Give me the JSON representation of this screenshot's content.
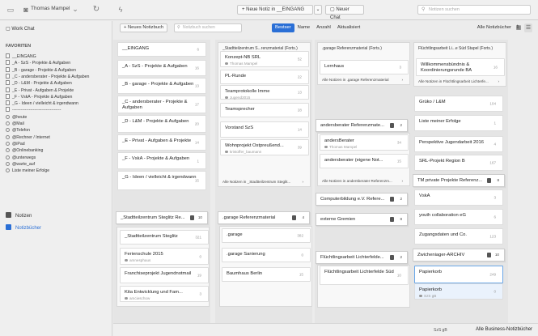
{
  "top": {
    "user": "Thomas Mampel",
    "new_note_label": "+ Neue Notiz in __EINGANG",
    "new_chat_label": "Neuer Chat",
    "search_placeholder": "Notizen suchen"
  },
  "sidebar": {
    "work_chat": "Work Chat",
    "favorites_heading": "FAVORITEN",
    "favorites": [
      {
        "label": "__EINGANG",
        "type": "notebook"
      },
      {
        "label": "_A - SzS - Projekte & Aufgaben",
        "type": "notebook"
      },
      {
        "label": "_B - garage - Projekte & Aufgaben",
        "type": "notebook"
      },
      {
        "label": "_C - andersberater - Projekte & Aufgaben",
        "type": "notebook"
      },
      {
        "label": "_D - L&M - Projekte & Aufgaben",
        "type": "notebook"
      },
      {
        "label": "_E - Privat - Aufgaben & Projekte",
        "type": "notebook"
      },
      {
        "label": "_F - VskA - Projekte & Aufgaben",
        "type": "notebook"
      },
      {
        "label": "_G - Ideen / vielleicht & irgendwann",
        "type": "notebook"
      },
      {
        "label": "-----------------------------------",
        "type": "notebook"
      },
      {
        "label": "@heute",
        "type": "tag"
      },
      {
        "label": "@Mail",
        "type": "tag"
      },
      {
        "label": "@Telefon",
        "type": "tag"
      },
      {
        "label": "@Rechner / Internet",
        "type": "tag"
      },
      {
        "label": "@iPad",
        "type": "tag"
      },
      {
        "label": "@Onlinebanking",
        "type": "tag"
      },
      {
        "label": "@unterwegs",
        "type": "tag"
      },
      {
        "label": "@warte_auf",
        "type": "tag"
      },
      {
        "label": "Liste meiner Erfolge",
        "type": "tag"
      }
    ],
    "notes_label": "Notizen",
    "notebooks_label": "Notizbücher"
  },
  "toolbar": {
    "new_notebook": "+ Neues Notizbuch",
    "search_placeholder": "Notizbuch suchen",
    "sort_options": [
      "Bestser",
      "Name",
      "Anzahl",
      "Aktualisiert"
    ],
    "sort_active": "Bestser",
    "filter_value": "Alle Notizbücher"
  },
  "col1": {
    "cards": [
      {
        "t": "__EINGANG",
        "n": "6"
      },
      {
        "t": "_A - SzS - Projekte & Aufgaben",
        "n": "16"
      },
      {
        "t": "_B - garage - Projekte & Aufgaben",
        "n": "13"
      },
      {
        "t": "_C - andersberater - Projekte & Aufgaben",
        "n": "17"
      },
      {
        "t": "_D - L&M - Projekte & Aufgaben",
        "n": "20"
      },
      {
        "t": "_E - Privat - Aufgaben & Projekte",
        "n": "14"
      },
      {
        "t": "_F - VskA - Projekte & Aufgaben",
        "n": "1"
      },
      {
        "t": "_G - Ideen / vielleicht & irgendwann",
        "n": "15"
      }
    ],
    "stack": {
      "t": "_Stadtteilzentrum Steglitz Re...",
      "n": "10"
    },
    "stack_cards": [
      {
        "t": "_Stadtteilzentrum Steglitz",
        "n": "321"
      },
      {
        "t": "Ferienschule 2015",
        "s": "amnesphaus",
        "n": "0"
      },
      {
        "t": "Franchiseprojekt Jugendnotmail",
        "n": "19"
      },
      {
        "t": "Kita Entwicklung und Fam...",
        "s": "amcieschow",
        "n": "3"
      }
    ]
  },
  "col2": {
    "header": "_Stadtteilzentrum S...renzmaterial (Forts.)",
    "cards": [
      {
        "t": "Konzept-NB SRL",
        "s": "Thomas Mampel",
        "n": "52"
      },
      {
        "t": "PL-Runde",
        "n": "22"
      },
      {
        "t": "Teamprotokolle Imme",
        "s": "Jugend2015",
        "n": "13"
      },
      {
        "t": "Teamsprecher",
        "n": "28"
      },
      {
        "t": "Vorstand SzS",
        "n": "14"
      },
      {
        "t": "Wohnprojekt Ostpreußend...",
        "s": "kristoffer_baumann",
        "n": "39"
      }
    ],
    "footer": "Alle Notizen in _Stadtteilzentrum Steglit...",
    "stack": {
      "t": ".garage Referenzmaterial",
      "n": "4"
    },
    "stack_cards": [
      {
        "t": ".garage",
        "n": "382"
      },
      {
        "t": ".garage Sanierung",
        "n": "0"
      },
      {
        "t": "Baumhaus Berlin",
        "n": "15"
      }
    ]
  },
  "col3": {
    "header": ".garage Referenzmaterial (Forts.)",
    "cards": [
      {
        "t": "Lernhaus",
        "n": "3"
      }
    ],
    "footer": "Alle Notizen in .garage Referenzmaterial",
    "stack1": {
      "t": "andersberater Referenzmate...",
      "n": "2"
    },
    "stack1_cards": [
      {
        "t": "andersBerater",
        "s": "Thomas Mampel",
        "n": "34"
      },
      {
        "t": "andersberater (eigene Not...",
        "n": "15"
      }
    ],
    "footer2": "Alle Notizen in andersberater Referenzm...",
    "stack2": {
      "t": "Computerbildung e.V. Refere...",
      "n": "2"
    },
    "stack3": {
      "t": "externe Gremien",
      "n": "8"
    },
    "stack4": {
      "t": "Flüchtlingsarbeit Lichterfelde...",
      "n": "2"
    },
    "stack4_cards": [
      {
        "t": "Flüchtlingsarbeit Lichterfelde Süd",
        "n": "10"
      }
    ]
  },
  "col4": {
    "header": "Flüchtlingsarbeit Li...e Süd Stapel (Forts.)",
    "cards": [
      {
        "t": "Willkommensbündnis & Koordinierungsrunde BA",
        "n": "16"
      }
    ],
    "footer": "Alle Notizen in Flüchtlingsarbeit Lichterfe...",
    "list": [
      {
        "t": "Grüko / L&M",
        "n": "104"
      },
      {
        "t": "Liste meiner Erfolge",
        "n": "1"
      },
      {
        "t": "Perspektive Jugendarbeit 2016",
        "n": "4"
      },
      {
        "t": "SRL-Projekt Region B",
        "n": "167"
      }
    ],
    "stack1": {
      "t": "TM private Projekte Referenz...",
      "n": "8"
    },
    "list2": [
      {
        "t": "VskA",
        "n": "3"
      },
      {
        "t": "youth collaboration eG",
        "n": "6"
      },
      {
        "t": "Zugangsdaten und Co.",
        "n": "123"
      }
    ],
    "stack2": {
      "t": "Zwicheniager-ARCHIV",
      "n": "10"
    },
    "papierkorb": {
      "t": "Papierkorb",
      "n": "249"
    },
    "papierkorb_sub": {
      "t": "Papierkorb",
      "s": "SzS gB",
      "n": "0"
    }
  },
  "bottom": {
    "left": "SzS gB",
    "right": "Alle Business-Notizbücher"
  }
}
